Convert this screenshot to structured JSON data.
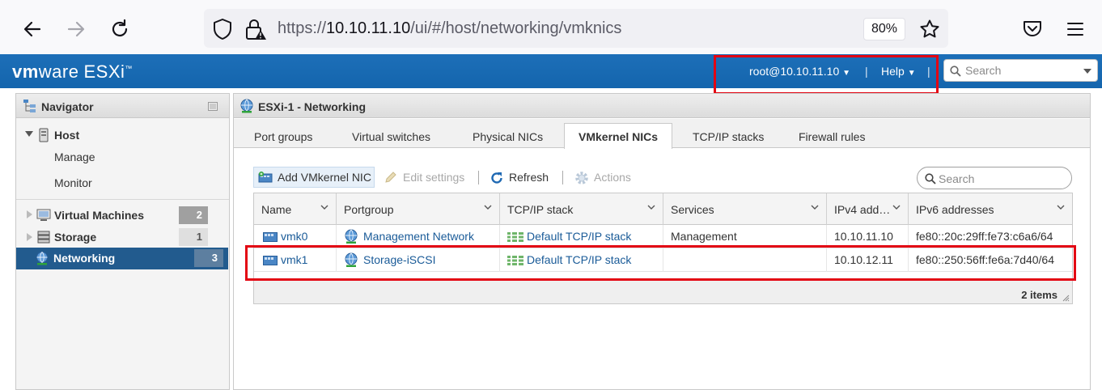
{
  "browser": {
    "url_prefix": "https://",
    "url_host": "10.10.11.10",
    "url_path": "/ui/#/host/networking/vmknics",
    "zoom": "80%"
  },
  "header": {
    "brand_vm": "vm",
    "brand_ware": "ware",
    "brand_product": "ESXi",
    "brand_tm": "™",
    "user_menu": "root@10.10.11.10",
    "help_menu": "Help",
    "search_placeholder": "Search"
  },
  "navigator": {
    "title": "Navigator",
    "host": "Host",
    "manage": "Manage",
    "monitor": "Monitor",
    "items": [
      {
        "label": "Virtual Machines",
        "count": "2"
      },
      {
        "label": "Storage",
        "count": "1"
      },
      {
        "label": "Networking",
        "count": "3"
      }
    ]
  },
  "main": {
    "title": "ESXi-1 - Networking",
    "tabs": [
      "Port groups",
      "Virtual switches",
      "Physical NICs",
      "VMkernel NICs",
      "TCP/IP stacks",
      "Firewall rules"
    ],
    "active_tab": "VMkernel NICs",
    "toolbar": {
      "add": "Add VMkernel NIC",
      "edit": "Edit settings",
      "refresh": "Refresh",
      "actions": "Actions",
      "search_placeholder": "Search"
    },
    "grid": {
      "columns": [
        "Name",
        "Portgroup",
        "TCP/IP stack",
        "Services",
        "IPv4 add…",
        "IPv6 addresses"
      ],
      "rows": [
        {
          "name": "vmk0",
          "portgroup": "Management Network",
          "stack": "Default TCP/IP stack",
          "services": "Management",
          "ipv4": "10.10.11.10",
          "ipv6": "fe80::20c:29ff:fe73:c6a6/64"
        },
        {
          "name": "vmk1",
          "portgroup": "Storage-iSCSI",
          "stack": "Default TCP/IP stack",
          "services": "",
          "ipv4": "10.10.12.11",
          "ipv6": "fe80::250:56ff:fe6a:7d40/64"
        }
      ],
      "footer": "2 items"
    }
  },
  "colors": {
    "header_blue": "#1465ad",
    "highlight_red": "#e30613",
    "nav_selected": "#225b8e",
    "link": "#1a5b98"
  }
}
